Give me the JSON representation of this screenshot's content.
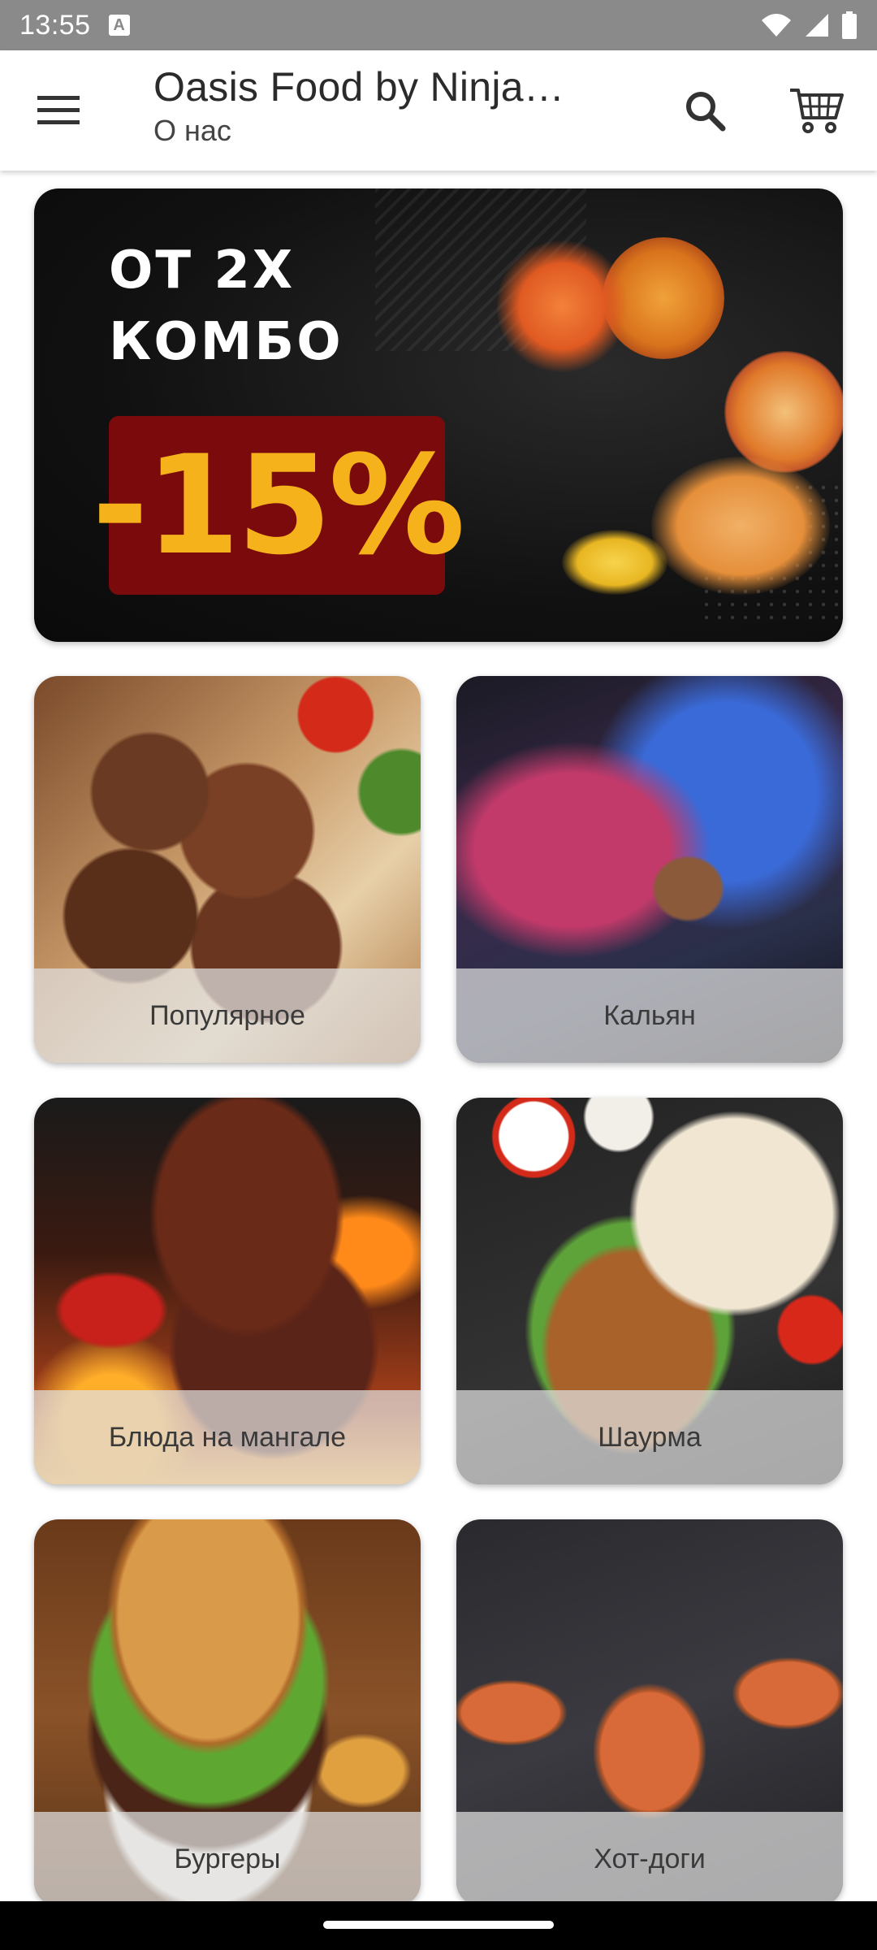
{
  "status_bar": {
    "time": "13:55",
    "notification_icon": "A"
  },
  "app_bar": {
    "title": "Oasis Food by Ninja…",
    "subtitle": "О нас",
    "menu_icon": "menu-icon",
    "search_icon": "search-icon",
    "cart_icon": "cart-icon"
  },
  "banner": {
    "line1": "ОТ 2Х",
    "line2": "КОМБО",
    "discount": "-15%",
    "colors": {
      "box": "#7a0a0c",
      "text": "#f5b21b"
    }
  },
  "categories": [
    {
      "label": "Популярное"
    },
    {
      "label": "Кальян"
    },
    {
      "label": "Блюда на мангале"
    },
    {
      "label": "Шаурма"
    },
    {
      "label": "Бургеры"
    },
    {
      "label": "Хот-доги"
    }
  ]
}
